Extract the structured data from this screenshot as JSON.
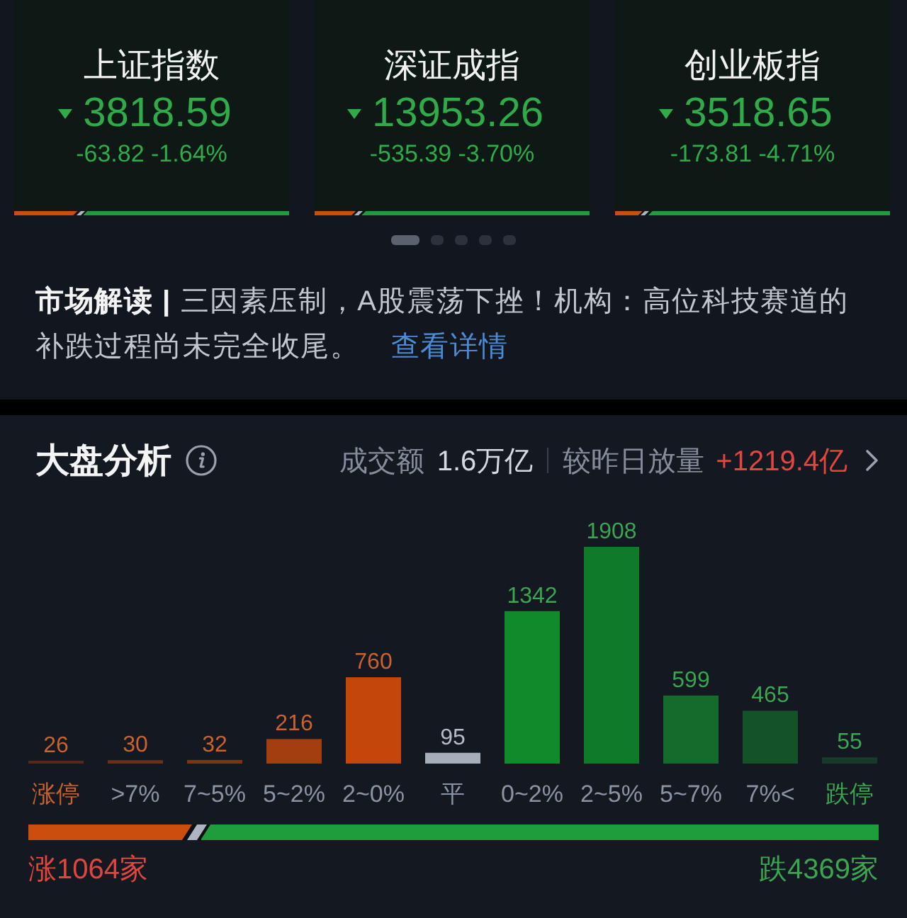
{
  "indices": [
    {
      "name": "上证指数",
      "value": "3818.59",
      "change": "-63.82 -1.64%",
      "falling": true,
      "breadth": {
        "level": 0.23
      }
    },
    {
      "name": "深证成指",
      "value": "13953.26",
      "change": "-535.39 -3.70%",
      "falling": true,
      "breadth": {
        "level": 0.15
      }
    },
    {
      "name": "创业板指",
      "value": "3518.65",
      "change": "-173.81 -4.71%",
      "falling": true,
      "breadth": {
        "level": 0.1
      }
    }
  ],
  "pager": [
    {
      "selected": true
    },
    {
      "selected": false
    },
    {
      "selected": false
    },
    {
      "selected": false
    },
    {
      "selected": false
    }
  ],
  "news": {
    "text": "**市场解读 |** 三因素压制，A股震荡下挫！机构：高位科技赛道的补跌过程尚未完全收尾。",
    "link": "查看详情"
  },
  "market_analysis": {
    "title": "大盘分析",
    "turnover_label": "成交额",
    "turnover": "1.6万亿",
    "compare_label": "较昨日放量",
    "compare": "+1219.4亿",
    "chart_data": {
      "type": "bar",
      "categories": [
        "涨停",
        ">7%",
        "7~5%",
        "5~2%",
        "2~0%",
        "平",
        "0~2%",
        "2~5%",
        "5~7%",
        "7%<",
        "跌停"
      ],
      "values": [
        26,
        30,
        32,
        216,
        760,
        95,
        1342,
        1908,
        599,
        465,
        55
      ],
      "colors": [
        "#52291c",
        "#6b3019",
        "#7d3515",
        "#a33f0e",
        "#c5460a",
        "#a7aebb",
        "#118a2c",
        "#107a2b",
        "#156b2b",
        "#14522a",
        "#173a29"
      ],
      "data_labels": true
    },
    "breadth": {
      "level": 0.1925,
      "up_label": "涨1064家",
      "down_label": "跌4369家"
    }
  }
}
